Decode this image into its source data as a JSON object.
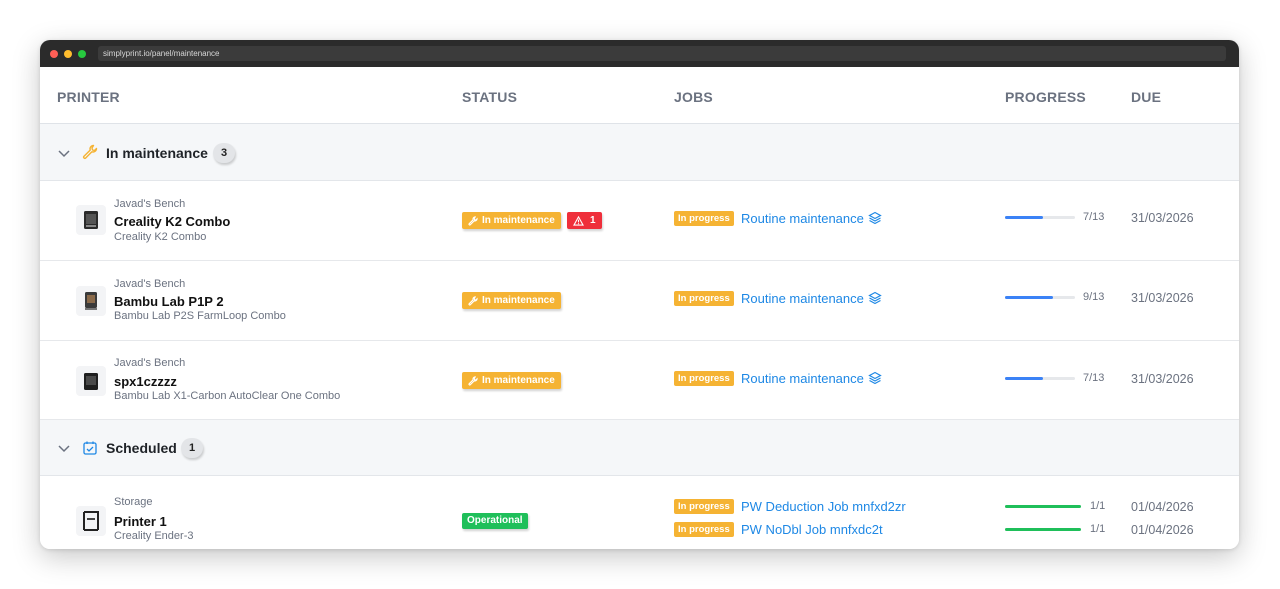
{
  "browser": {
    "url": "simplyprint.io/panel/maintenance"
  },
  "columns": {
    "printer": "PRINTER",
    "status": "STATUS",
    "jobs": "JOBS",
    "progress": "PROGRESS",
    "due": "DUE"
  },
  "groups": [
    {
      "title": "In maintenance",
      "count": "3",
      "icon": "wrench-icon",
      "rows": [
        {
          "location": "Javad's Bench",
          "name": "Creality K2 Combo",
          "model": "Creality K2 Combo",
          "status": "In maintenance",
          "alert": "1",
          "job_state": "In progress",
          "job": "Routine maintenance",
          "progress_text": "7/13",
          "progress": 0.538,
          "due": "31/03/2026"
        },
        {
          "location": "Javad's Bench",
          "name": "Bambu Lab P1P 2",
          "model": "Bambu Lab P2S FarmLoop Combo",
          "status": "In maintenance",
          "job_state": "In progress",
          "job": "Routine maintenance",
          "progress_text": "9/13",
          "progress": 0.692,
          "due": "31/03/2026"
        },
        {
          "location": "Javad's Bench",
          "name": "spx1czzzz",
          "model": "Bambu Lab X1-Carbon AutoClear One Combo",
          "status": "In maintenance",
          "job_state": "In progress",
          "job": "Routine maintenance",
          "progress_text": "7/13",
          "progress": 0.538,
          "due": "31/03/2026"
        }
      ]
    },
    {
      "title": "Scheduled",
      "count": "1",
      "icon": "calendar-check-icon",
      "rows": [
        {
          "location": "Storage",
          "name": "Printer 1",
          "model": "Creality Ender-3",
          "status": "Operational",
          "jobs": [
            {
              "job_state": "In progress",
              "job": "PW Deduction Job mnfxd2zr",
              "progress_text": "1/1",
              "progress": 1.0,
              "due": "01/04/2026"
            },
            {
              "job_state": "In progress",
              "job": "PW NoDbl Job mnfxdc2t",
              "progress_text": "1/1",
              "progress": 1.0,
              "due": "01/04/2026"
            }
          ]
        }
      ]
    }
  ],
  "colors": {
    "accent_blue": "#1e88e5",
    "progress_blue": "#3b82f6",
    "progress_green": "#1fbf5a",
    "maintenance": "#f5b333",
    "alert": "#ef2f3b",
    "operational": "#1fbf5a"
  }
}
